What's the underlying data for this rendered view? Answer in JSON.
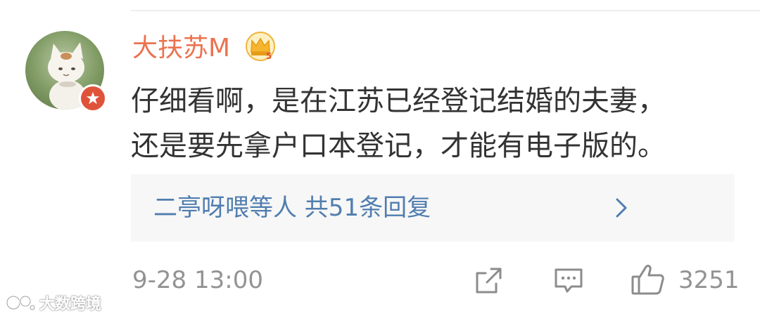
{
  "comment": {
    "username": "大扶苏M",
    "text_lines": [
      "仔细看啊，是在江苏已经登记结婚的夫妻，",
      "还是要先拿户口本登记，才能有电子版的。"
    ],
    "replies_summary": "二亭呀喂等人  共51条回复",
    "timestamp": "9-28 13:00",
    "like_count": "3251"
  },
  "icons": {
    "avatar": "cat-avatar",
    "avatar_badge": "verified-star-icon",
    "vip": "crown-icon",
    "replies": "chevron-right-icon",
    "share": "share-icon",
    "comment": "comment-icon",
    "like": "thumbs-up-icon"
  },
  "watermark": {
    "text": "大数跨境"
  },
  "colors": {
    "username": "#eb7350",
    "link": "#507daf",
    "meta": "#939393",
    "reply_bg": "#f7f7f7",
    "badge": "#e0533b"
  }
}
